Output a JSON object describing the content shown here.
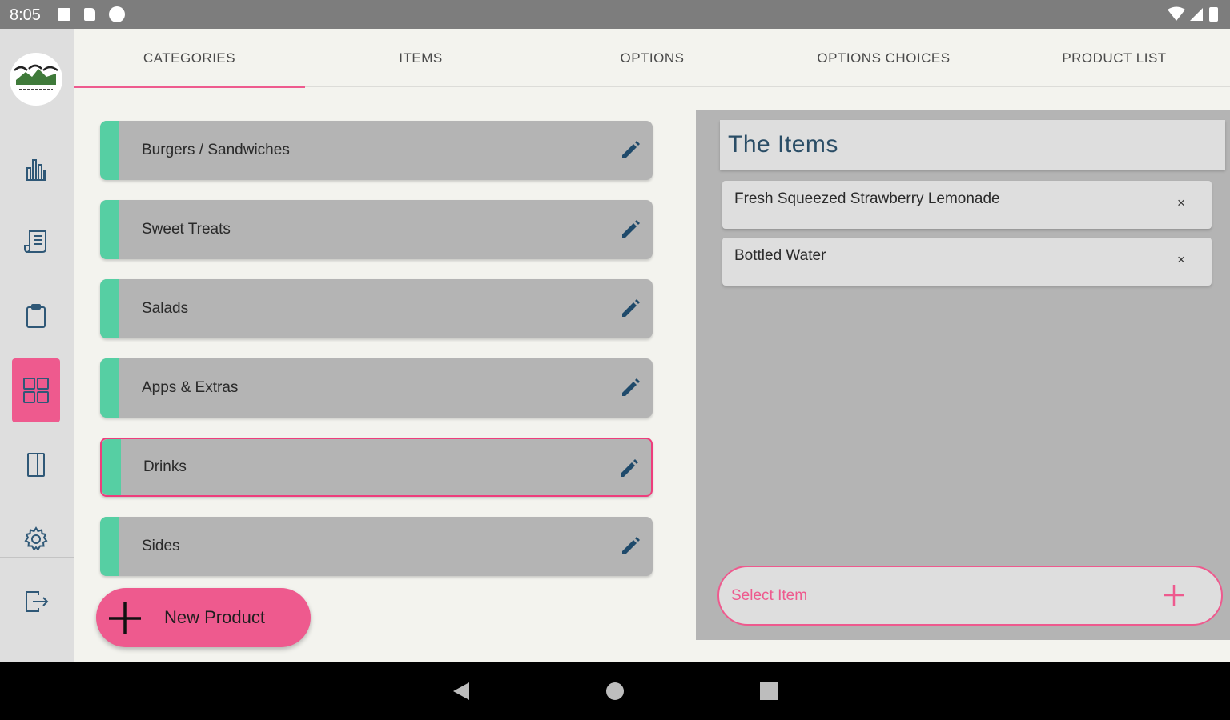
{
  "status_bar": {
    "time": "8:05"
  },
  "tabs": [
    {
      "label": "CATEGORIES",
      "active": true
    },
    {
      "label": "ITEMS",
      "active": false
    },
    {
      "label": "OPTIONS",
      "active": false
    },
    {
      "label": "OPTIONS CHOICES",
      "active": false
    },
    {
      "label": "PRODUCT LIST",
      "active": false
    }
  ],
  "sidebar": {
    "items": [
      {
        "icon": "bar-chart-icon"
      },
      {
        "icon": "receipt-icon"
      },
      {
        "icon": "clipboard-icon"
      },
      {
        "icon": "grid-icon",
        "active": true
      },
      {
        "icon": "sidebar-panel-icon"
      },
      {
        "icon": "gear-icon"
      },
      {
        "icon": "logout-icon"
      }
    ]
  },
  "categories": [
    {
      "label": "Burgers / Sandwiches"
    },
    {
      "label": "Sweet Treats"
    },
    {
      "label": "Salads"
    },
    {
      "label": "Apps & Extras"
    },
    {
      "label": "Drinks",
      "selected": true
    },
    {
      "label": "Sides"
    }
  ],
  "new_product": {
    "label": "New Product"
  },
  "items_panel": {
    "title": "The Items",
    "items": [
      {
        "label": "Fresh Squeezed Strawberry Lemonade",
        "remove": "×"
      },
      {
        "label": "Bottled Water",
        "remove": "×"
      }
    ],
    "select_placeholder": "Select Item"
  },
  "colors": {
    "accent": "#ee5a8e",
    "stripe": "#56cfa3",
    "card": "#b4b4b4",
    "title_text": "#2a4d66",
    "edit_icon": "#1f4a6b"
  }
}
